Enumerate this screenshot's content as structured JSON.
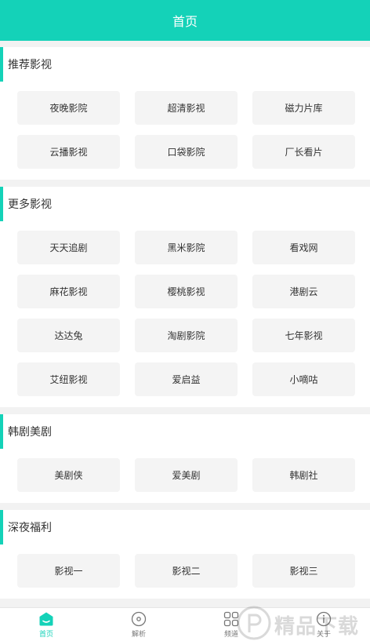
{
  "header": {
    "title": "首页"
  },
  "sections": [
    {
      "title": "推荐影视",
      "items": [
        "夜晚影院",
        "超清影视",
        "磁力片库",
        "云播影视",
        "口袋影院",
        "厂长看片"
      ]
    },
    {
      "title": "更多影视",
      "items": [
        "天天追剧",
        "黑米影院",
        "看戏网",
        "麻花影视",
        "樱桃影视",
        "港剧云",
        "达达兔",
        "淘剧影院",
        "七年影视",
        "艾纽影视",
        "爱启益",
        "小嘀咕"
      ]
    },
    {
      "title": "韩剧美剧",
      "items": [
        "美剧侠",
        "爱美剧",
        "韩剧社"
      ]
    },
    {
      "title": "深夜福利",
      "items": [
        "影视一",
        "影视二",
        "影视三"
      ]
    }
  ],
  "tabbar": {
    "tabs": [
      {
        "label": "首页",
        "icon": "home-icon",
        "active": true
      },
      {
        "label": "解析",
        "icon": "disc-icon",
        "active": false
      },
      {
        "label": "频道",
        "icon": "grid-icon",
        "active": false
      },
      {
        "label": "关于",
        "icon": "info-icon",
        "active": false
      }
    ]
  },
  "colors": {
    "accent": "#14d2b8",
    "background": "#f2f2f2",
    "cell": "#f4f4f4"
  },
  "watermark": {
    "text": "精品下载"
  }
}
